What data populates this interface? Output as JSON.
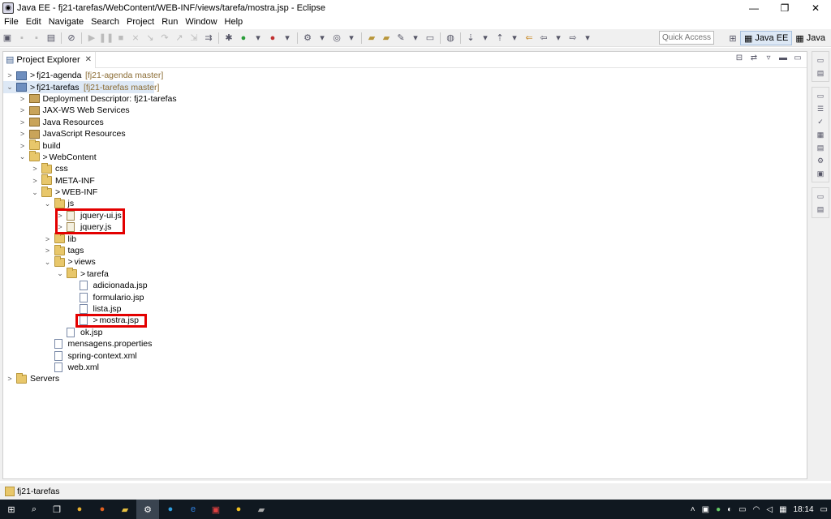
{
  "window": {
    "title": "Java EE - fj21-tarefas/WebContent/WEB-INF/views/tarefa/mostra.jsp - Eclipse",
    "min_glyph": "—",
    "restore_glyph": "❐",
    "close_glyph": "✕"
  },
  "menu": [
    "File",
    "Edit",
    "Navigate",
    "Search",
    "Project",
    "Run",
    "Window",
    "Help"
  ],
  "toolbar": {
    "quick_access_placeholder": "Quick Access",
    "perspectives": [
      {
        "label": "Java EE",
        "active": true
      },
      {
        "label": "Java",
        "active": false
      }
    ]
  },
  "view": {
    "tab_label": "Project Explorer",
    "tab_close": "✕"
  },
  "tree": [
    {
      "label": "fj21-agenda",
      "decor": "[fj21-agenda master]",
      "prefix": ">",
      "expanded": false
    },
    {
      "label": "fj21-tarefas",
      "decor": "[fj21-tarefas master]",
      "prefix": ">",
      "expanded": true
    },
    {
      "label": "Deployment Descriptor: fj21-tarefas"
    },
    {
      "label": "JAX-WS Web Services"
    },
    {
      "label": "Java Resources"
    },
    {
      "label": "JavaScript Resources"
    },
    {
      "label": "build"
    },
    {
      "label": "WebContent",
      "prefix": ">"
    },
    {
      "label": "css"
    },
    {
      "label": "META-INF"
    },
    {
      "label": "WEB-INF",
      "prefix": ">"
    },
    {
      "label": "js"
    },
    {
      "label": "jquery-ui.js"
    },
    {
      "label": "jquery.js"
    },
    {
      "label": "lib"
    },
    {
      "label": "tags"
    },
    {
      "label": "views",
      "prefix": ">"
    },
    {
      "label": "tarefa",
      "prefix": ">"
    },
    {
      "label": "adicionada.jsp"
    },
    {
      "label": "formulario.jsp"
    },
    {
      "label": "lista.jsp"
    },
    {
      "label": "mostra.jsp",
      "prefix": ">"
    },
    {
      "label": "ok.jsp"
    },
    {
      "label": "mensagens.properties"
    },
    {
      "label": "spring-context.xml"
    },
    {
      "label": "web.xml"
    },
    {
      "label": "Servers"
    }
  ],
  "status": {
    "text": "fj21-tarefas"
  },
  "taskbar": {
    "clock": "18:14"
  },
  "colors": {
    "highlight_box": "#e30000",
    "selection": "#dde8f5",
    "taskbar": "#101820"
  }
}
